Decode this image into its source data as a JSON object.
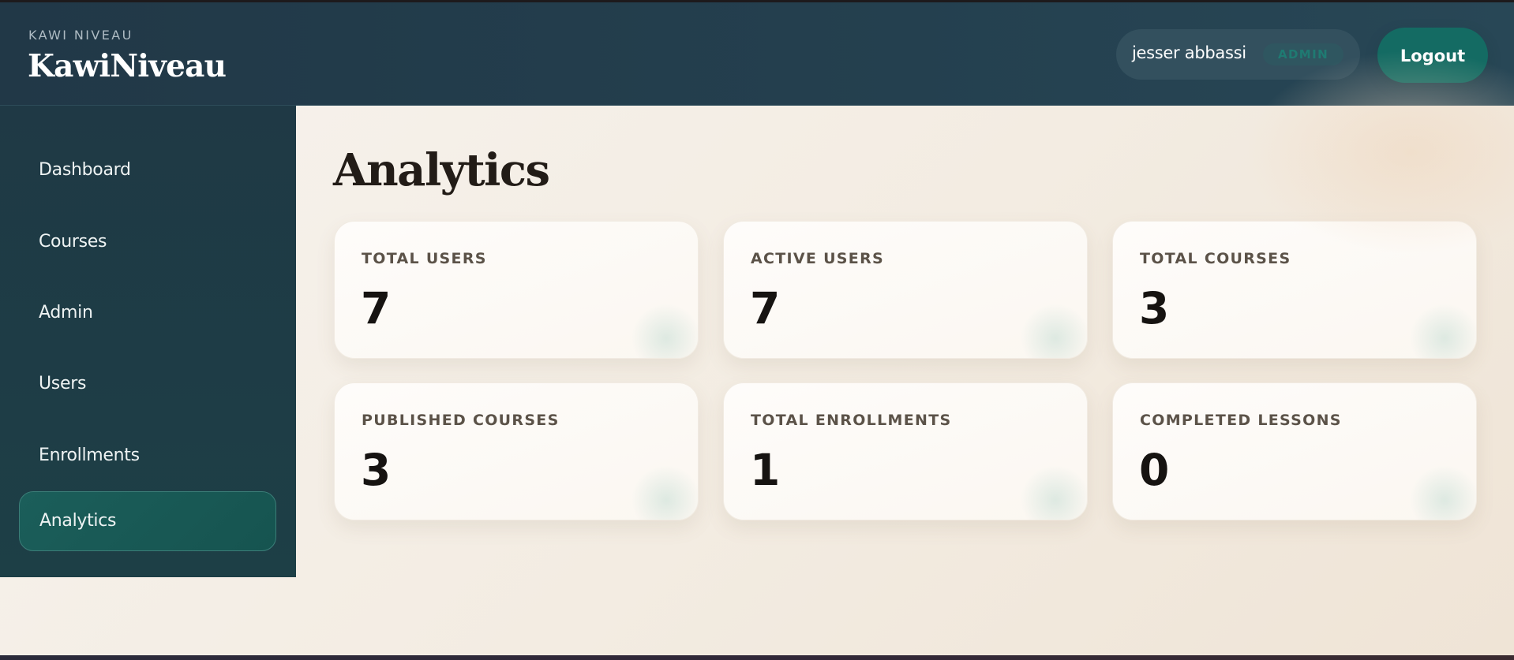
{
  "header": {
    "brand_small": "KAWI NIVEAU",
    "brand_name": "KawiNiveau",
    "user_name": "jesser abbassi",
    "user_role": "ADMIN",
    "logout_label": "Logout"
  },
  "sidebar": {
    "items": [
      {
        "label": "Dashboard"
      },
      {
        "label": "Courses"
      },
      {
        "label": "Admin"
      },
      {
        "label": "Users"
      },
      {
        "label": "Enrollments"
      },
      {
        "label": "Analytics"
      }
    ],
    "active": "Analytics"
  },
  "main": {
    "title": "Analytics",
    "stats": [
      {
        "label": "TOTAL USERS",
        "value": "7"
      },
      {
        "label": "ACTIVE USERS",
        "value": "7"
      },
      {
        "label": "TOTAL COURSES",
        "value": "3"
      },
      {
        "label": "PUBLISHED COURSES",
        "value": "3"
      },
      {
        "label": "TOTAL ENROLLMENTS",
        "value": "1"
      },
      {
        "label": "COMPLETED LESSONS",
        "value": "0"
      }
    ]
  },
  "colors": {
    "header_bg": "#24404f",
    "sidebar_bg": "#1f3945",
    "accent": "#146b63",
    "page_bg": "#f4ede3",
    "card_bg": "#fdfaf6"
  }
}
